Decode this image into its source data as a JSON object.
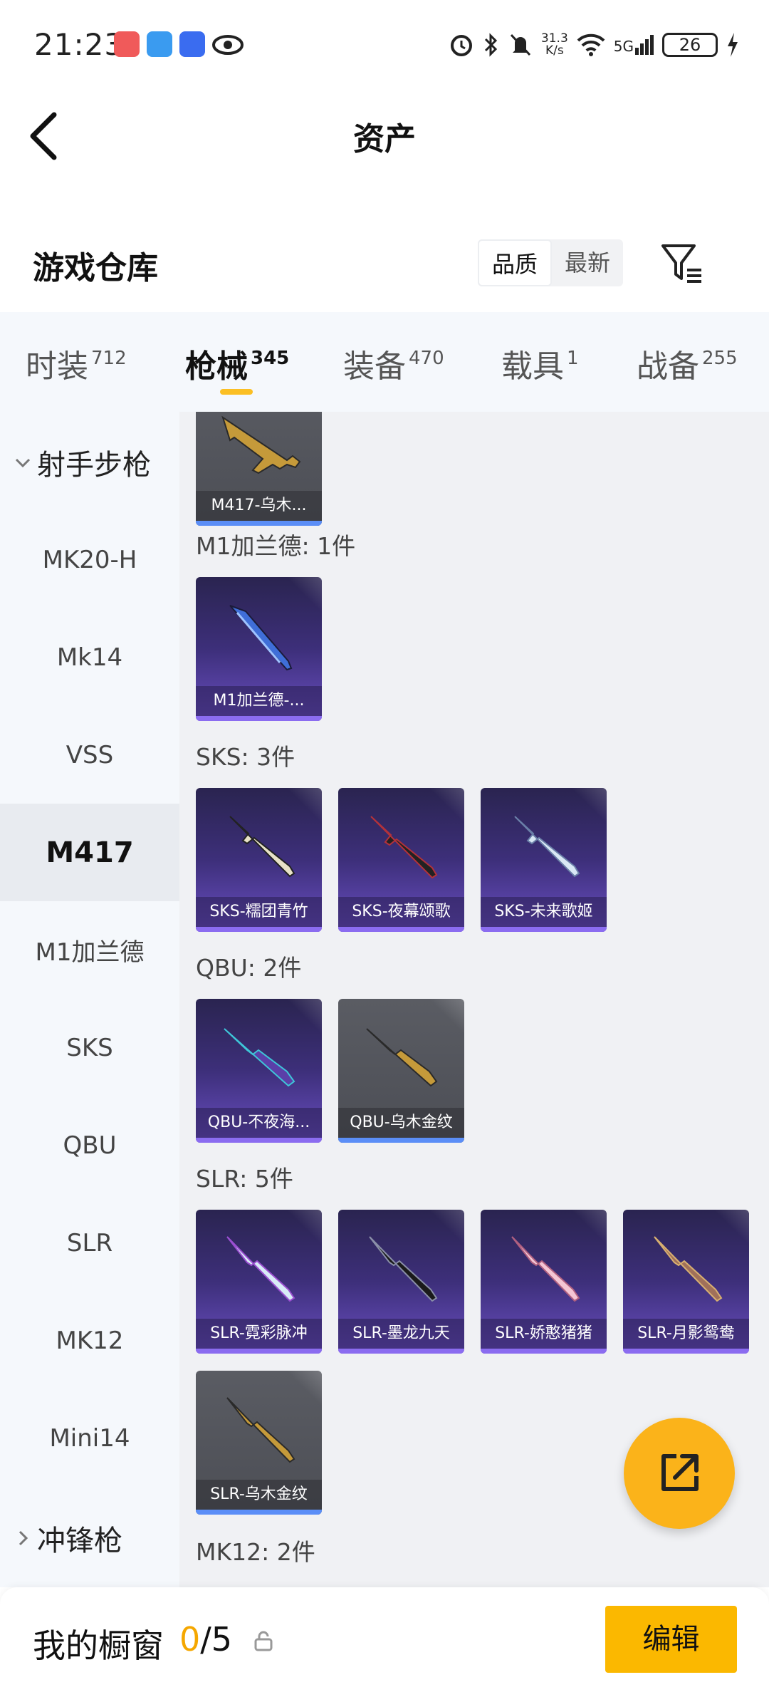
{
  "status_bar": {
    "time": "21:23",
    "speed_value": "31.3",
    "speed_unit": "K/s",
    "network": "5G",
    "battery": "26"
  },
  "header": {
    "title": "资产"
  },
  "warehouse": {
    "title": "游戏仓库",
    "sort_options": [
      "品质",
      "最新"
    ],
    "active_sort": "品质"
  },
  "tabs": [
    {
      "label": "时装",
      "count": "712"
    },
    {
      "label": "枪械",
      "count": "345"
    },
    {
      "label": "装备",
      "count": "470"
    },
    {
      "label": "载具",
      "count": "1"
    },
    {
      "label": "战备",
      "count": "255"
    }
  ],
  "active_tab": "枪械",
  "sidebar": {
    "group_expanded": "射手步枪",
    "items": [
      "MK20-H",
      "Mk14",
      "VSS",
      "M417",
      "M1加兰德",
      "SKS",
      "QBU",
      "SLR",
      "MK12",
      "Mini14"
    ],
    "active_item": "M417",
    "group_collapsed": "冲锋枪"
  },
  "content": {
    "groups": [
      {
        "label": "",
        "cards": [
          {
            "name": "M417-乌木...",
            "style": "grey"
          }
        ]
      },
      {
        "label": "M1加兰德: 1件",
        "cards": [
          {
            "name": "M1加兰德-...",
            "style": "purple"
          }
        ]
      },
      {
        "label": "SKS: 3件",
        "cards": [
          {
            "name": "SKS-糯团青竹",
            "style": "purple"
          },
          {
            "name": "SKS-夜幕颂歌",
            "style": "purple"
          },
          {
            "name": "SKS-未来歌姬",
            "style": "purple"
          }
        ]
      },
      {
        "label": "QBU: 2件",
        "cards": [
          {
            "name": "QBU-不夜海...",
            "style": "purple"
          },
          {
            "name": "QBU-乌木金纹",
            "style": "grey"
          }
        ]
      },
      {
        "label": "SLR: 5件",
        "cards": [
          {
            "name": "SLR-霓彩脉冲",
            "style": "purple"
          },
          {
            "name": "SLR-墨龙九天",
            "style": "purple"
          },
          {
            "name": "SLR-娇憨猪猪",
            "style": "purple"
          },
          {
            "name": "SLR-月影鸳鸯",
            "style": "purple"
          },
          {
            "name": "SLR-乌木金纹",
            "style": "grey"
          }
        ]
      },
      {
        "label": "MK12: 2件",
        "cards": []
      }
    ]
  },
  "bottom_bar": {
    "my_window": "我的橱窗",
    "count_current": "0",
    "count_total": "/5",
    "edit_label": "编辑"
  },
  "colors": {
    "accent": "#fbb800",
    "purple_card": "#3d2f7a",
    "grey_card": "#55575e"
  }
}
